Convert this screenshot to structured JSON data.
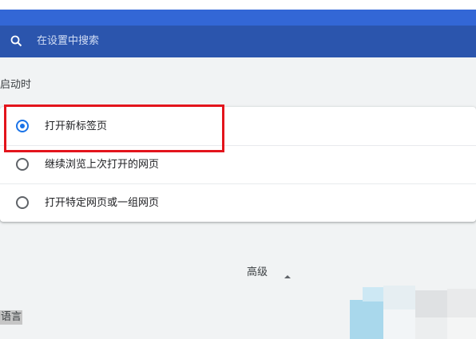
{
  "search": {
    "placeholder": "在设置中搜索"
  },
  "startup": {
    "title": "启动时",
    "options": [
      {
        "label": "打开新标签页",
        "selected": true
      },
      {
        "label": "继续浏览上次打开的网页",
        "selected": false
      },
      {
        "label": "打开特定网页或一组网页",
        "selected": false
      }
    ]
  },
  "advanced": {
    "label": "高级"
  },
  "language": {
    "label": "语言"
  },
  "colors": {
    "header": "#3367d6",
    "search_box": "#2b55ad",
    "radio_selected": "#1a73e8",
    "highlight": "#e3141c"
  }
}
